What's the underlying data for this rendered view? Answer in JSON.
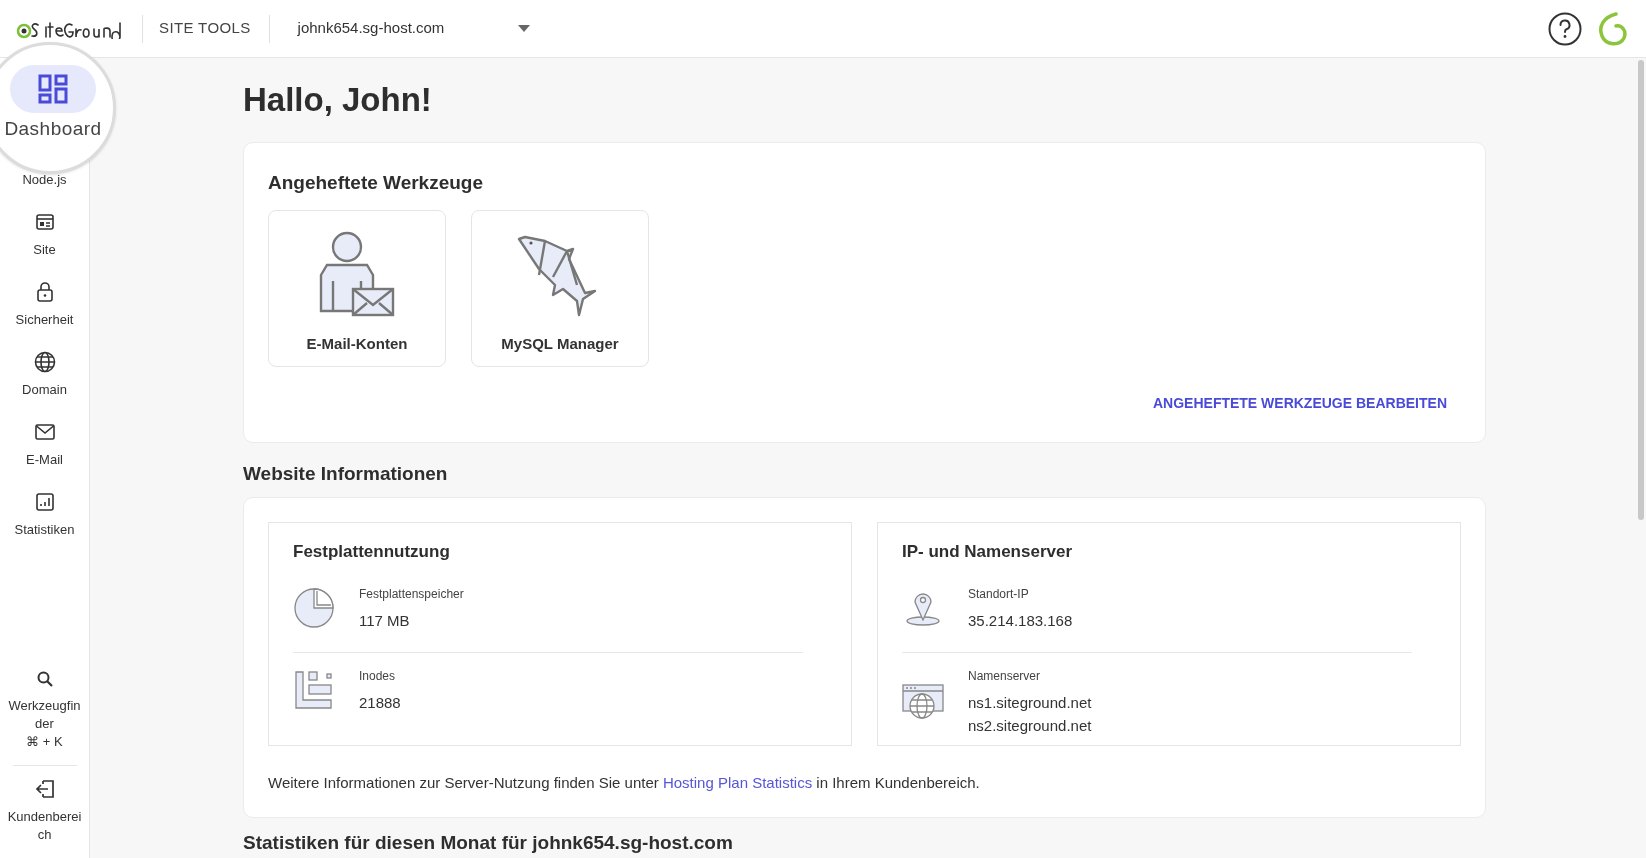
{
  "topbar": {
    "product": "SITE TOOLS",
    "site": "johnk654.sg-host.com"
  },
  "sidebar": {
    "items": [
      {
        "label": "Dashboard",
        "selected": true
      },
      {
        "label": "Node.js",
        "selected": false
      },
      {
        "label": "Site",
        "selected": false
      },
      {
        "label": "Sicherheit",
        "selected": false
      },
      {
        "label": "Domain",
        "selected": false
      },
      {
        "label": "E-Mail",
        "selected": false
      },
      {
        "label": "Statistiken",
        "selected": false
      }
    ],
    "bottom_items": [
      {
        "label": "Werkzeugfinder",
        "shortcut": "⌘ + K"
      },
      {
        "label": "Kundenbereich"
      }
    ]
  },
  "greeting": "Hallo, John!",
  "pinned": {
    "title": "Angeheftete Werkzeuge",
    "tools": [
      {
        "label": "E-Mail-Konten"
      },
      {
        "label": "MySQL Manager"
      }
    ],
    "edit_link": "ANGEHEFTETE WERKZEUGE BEARBEITEN"
  },
  "website_info": {
    "title": "Website Informationen",
    "panels": [
      {
        "title": "Festplattennutzung",
        "rows": [
          {
            "label": "Festplattenspeicher",
            "values": [
              "117 MB"
            ]
          },
          {
            "label": "Inodes",
            "values": [
              "21888"
            ]
          }
        ]
      },
      {
        "title": "IP- und Namenserver",
        "rows": [
          {
            "label": "Standort-IP",
            "values": [
              "35.214.183.168"
            ]
          },
          {
            "label": "Namenserver",
            "values": [
              "ns1.siteground.net",
              "ns2.siteground.net"
            ]
          }
        ]
      }
    ],
    "note": "Weitere Informationen zur Server-Nutzung finden Sie unter ",
    "note_link": "Hosting Plan Statistics",
    "note_end": " in Ihrem Kundenbereich."
  },
  "next_section_title": "Statistiken für diesen Monat für johnk654.sg-host.com"
}
